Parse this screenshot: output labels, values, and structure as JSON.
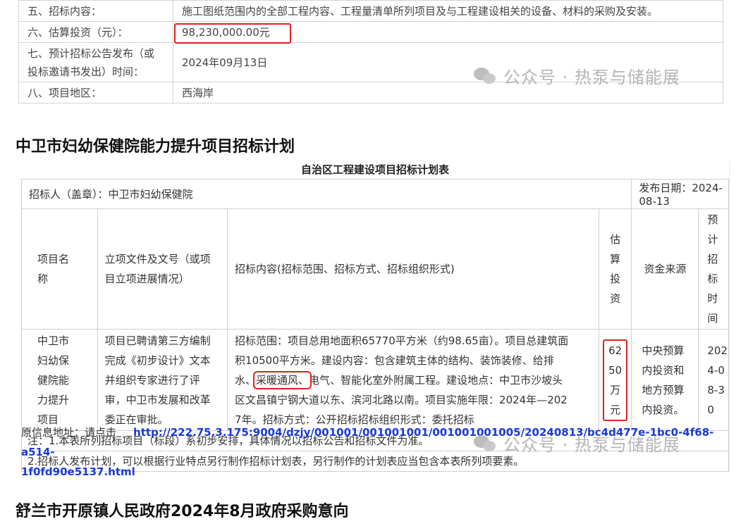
{
  "top_table": {
    "rows": [
      {
        "key": "五、招标内容：",
        "value": "施工图纸范围内的全部工程内容、工程量清单所列项目及与工程建设相关的设备、材料的采购及安装。"
      },
      {
        "key": "六、估算投资（元）：",
        "value": "98,230,000.00元"
      },
      {
        "key": "七、预计招标公告发布（或投标邀请书发出）时间：",
        "key_line1": "七、预计招标公告发布（或",
        "key_line2": "投标邀请书发出）时间：",
        "value": "2024年09月13日"
      },
      {
        "key": "八、项目地区：",
        "value": "西海岸"
      }
    ]
  },
  "watermark_text": "公众号 · 热泵与储能展",
  "section1_title": "中卫市妇幼保健院能力提升项目招标计划",
  "plan": {
    "title": "自治区工程建设项目招标计划表",
    "tenderer": "招标人（盖章）：中卫市妇幼保健院",
    "publish_date": "发布日期：2024-08-13",
    "headers": {
      "name": [
        "项目名",
        "称"
      ],
      "doc": [
        "立项文件及文号（或项",
        "目立项进展情况）"
      ],
      "content": "招标内容(招标范围、招标方式、招标组织形式)",
      "invest": [
        "估",
        "算",
        "投",
        "资"
      ],
      "fund": "资金来源",
      "time": [
        "预计",
        "招标",
        "时间"
      ]
    },
    "row": {
      "name": [
        "中卫市",
        "妇幼保",
        "健院能",
        "力提升",
        "项目"
      ],
      "doc": [
        "项目已聘请第三方编制",
        "完成《初步设计》文本",
        "并组织专家进行了评",
        "审，中卫市发展和改革",
        "委正在审批。"
      ],
      "content": [
        "招标范围：项目总用地面积65770平方米（约98.65亩）。项目总建筑面",
        "积10500平方米。建设内容：包含建筑主体的结构、装饰装修、给排",
        "水、采暖通风、电气、智能化室外附属工程。建设地点：中卫市沙坡头",
        "区文昌镇宁钢大道以东、滨河北路以南。项目实施年限：2024年—202",
        "7年。招标方式：公开招标招标组织形式：委托招标"
      ],
      "content_line3_a": "水、",
      "content_line3_b": "采暖通风、",
      "content_line3_c": "电气、智能化室外附属工程。建设地点：中卫市沙坡头",
      "invest": [
        "62",
        "50",
        "万",
        "元"
      ],
      "fund": [
        "中央预算",
        "内投资和",
        "地方预算",
        "内投资。"
      ],
      "time": [
        "202",
        "4-0",
        "8-3",
        "0"
      ]
    },
    "notes": [
      "注：1.本表所列招标项目（标段）系初步安排，具体情况以招标公告和招标文件为准。",
      "2.招标人发布计划，可以根据行业特点另行制作招标计划表，另行制作的计划表应当包含本表所列项要素。"
    ]
  },
  "source": {
    "label": "原信息地址：请点击",
    "url_line1": "http://222.75.3.175:9004/dzjy/001001/001001001/001001001005/20240813/bc4d477e-1bc0-4f68-a514-",
    "url_line2": "1f0fd90e5137.html"
  },
  "section2_title": "舒兰市开原镇人民政府2024年8月政府采购意向",
  "colors": {
    "highlight": "#e02020",
    "link": "#1a3ad6"
  }
}
